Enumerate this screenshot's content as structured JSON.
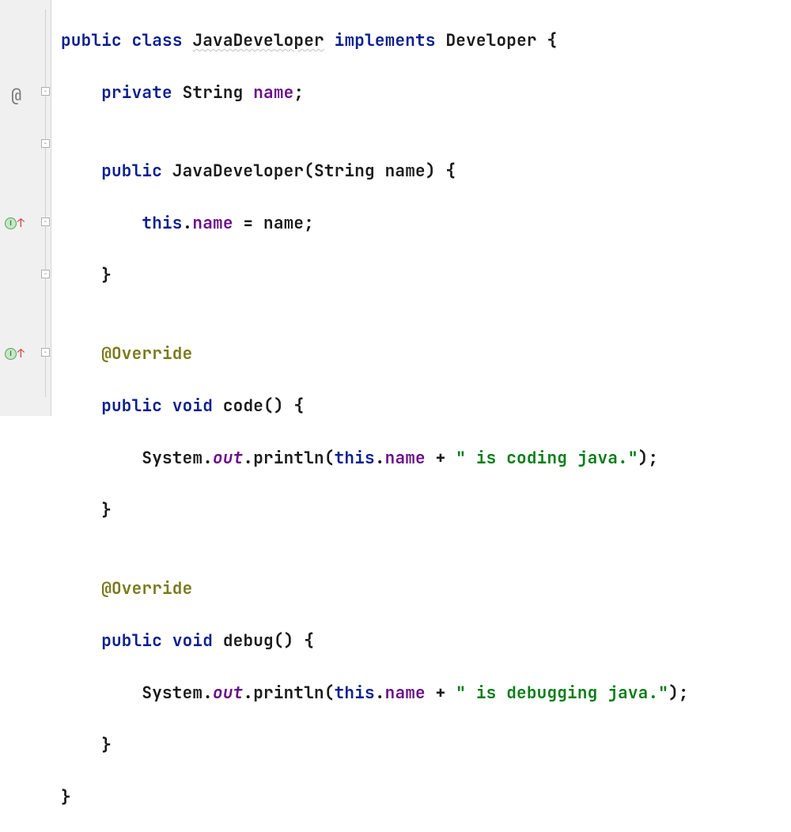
{
  "gutter": {
    "annotation_symbol": "@",
    "impl_marker": {
      "letter": "I",
      "arrow": "↑"
    }
  },
  "code": {
    "l1": {
      "kw_public": "public",
      "kw_class": "class",
      "classname": "JavaDeveloper",
      "kw_implements": "implements",
      "iface": "Developer",
      "brace": " {"
    },
    "l2": {
      "kw_private": "private",
      "type": "String",
      "field": "name",
      "semi": ";"
    },
    "l3": "",
    "l4": {
      "kw_public": "public",
      "ctor": "JavaDeveloper",
      "params": "(String name) {"
    },
    "l5": {
      "kw_this": "this",
      "dot": ".",
      "field": "name",
      "eq": " = name;"
    },
    "l6": "    }",
    "l7": "",
    "l8": {
      "ann": "@Override"
    },
    "l9": {
      "kw_public": "public",
      "kw_void": "void",
      "mname": "code",
      "params": "() {"
    },
    "l10": {
      "sys": "System.",
      "out": "out",
      "print": ".println(",
      "kw_this": "this",
      "dot": ".",
      "field": "name",
      "plus": " + ",
      "str": "\" is coding java.\"",
      "close": ");"
    },
    "l11": "    }",
    "l12": "",
    "l13": {
      "ann": "@Override"
    },
    "l14": {
      "kw_public": "public",
      "kw_void": "void",
      "mname": "debug",
      "params": "() {"
    },
    "l15": {
      "sys": "System.",
      "out": "out",
      "print": ".println(",
      "kw_this": "this",
      "dot": ".",
      "field": "name",
      "plus": " + ",
      "str": "\" is debugging java.\"",
      "close": ");"
    },
    "l16": "    }",
    "l17": "}"
  }
}
